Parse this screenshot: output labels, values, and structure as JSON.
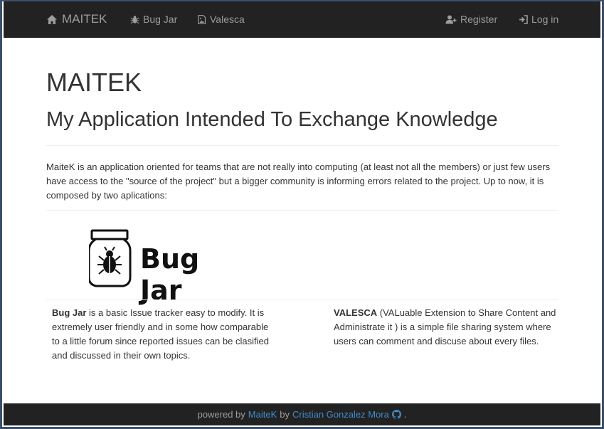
{
  "navbar": {
    "brand": "MAITEK",
    "links": [
      {
        "label": "Bug Jar"
      },
      {
        "label": "Valesca"
      }
    ],
    "register": "Register",
    "login": "Log in"
  },
  "main": {
    "title": "MAITEK",
    "subtitle": "My Application Intended To Exchange Knowledge",
    "intro": "MaiteK is an application oriented for teams that are not really into computing (at least not all the members) or just few users have access to the \"source of the project\" but a bigger community is informing errors related to the project. Up to now, it is composed by two aplications:",
    "logo_text": "Bug Jar",
    "bugjar": {
      "name": "Bug Jar",
      "description": " is a basic Issue tracker easy to modify. It is extremely user friendly and in some how comparable to a little forum since reported issues can be clasified and discussed in their own topics."
    },
    "valesca": {
      "name": "VALESCA",
      "description": " (VALuable Extension to Share Content and Administrate it ) is a simple file sharing system where users can comment and discuse about every files."
    }
  },
  "footer": {
    "powered_by": "powered by",
    "maitek_link": "MaiteK",
    "by": "by",
    "author_link": "Cristian Gonzalez Mora",
    "end": "."
  }
}
